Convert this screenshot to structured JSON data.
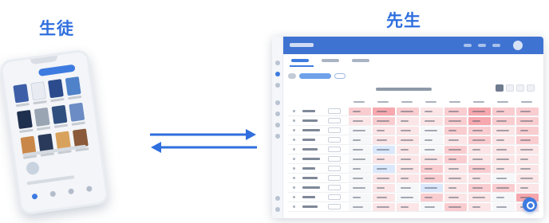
{
  "headings": {
    "student": "生徒",
    "teacher": "先生"
  },
  "colors": {
    "accent": "#2f6fde",
    "arrow": "#2f6fde",
    "heat_high": "#f6a8ae",
    "heat_mid": "#f9cdd0",
    "heat_low": "#fbe5e6",
    "heat_blue": "#dbe7fb",
    "heat_plain": "#f6f7f9"
  },
  "arrows": {
    "to_right": "arrow-right-icon",
    "to_left": "arrow-left-icon"
  }
}
